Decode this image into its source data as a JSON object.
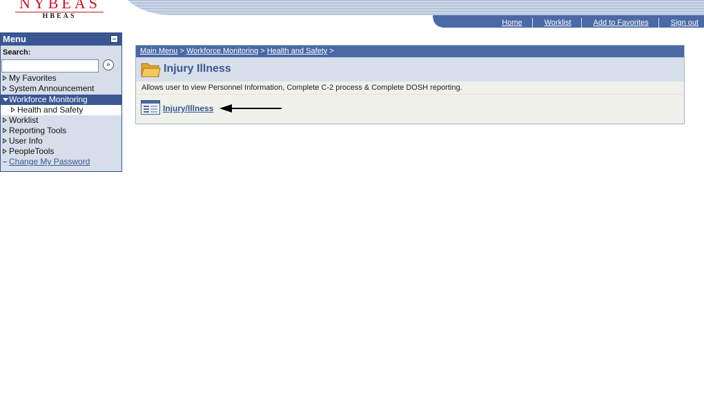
{
  "logo": {
    "title": "NYBEAS",
    "subtitle": "HBEAS"
  },
  "topnav": [
    "Home",
    "Worklist",
    "Add to Favorites",
    "Sign out"
  ],
  "menu": {
    "title": "Menu",
    "search_label": "Search:",
    "search_value": "",
    "search_button_glyph": "»",
    "items": [
      {
        "label": "My Favorites"
      },
      {
        "label": "System Announcement"
      },
      {
        "label": "Workforce Monitoring"
      },
      {
        "label": "Health and Safety"
      },
      {
        "label": "Worklist"
      },
      {
        "label": "Reporting Tools"
      },
      {
        "label": "User Info"
      },
      {
        "label": "PeopleTools"
      },
      {
        "label": "Change My Password"
      }
    ]
  },
  "breadcrumb": {
    "items": [
      "Main Menu",
      "Workforce Monitoring",
      "Health and Safety"
    ],
    "separator": " > "
  },
  "page": {
    "title": "Injury Illness",
    "description": "Allows user to view Personnel Information, Complete C-2 process & Complete DOSH reporting.",
    "link_label": "Injury/Illness"
  },
  "colors": {
    "header_blue": "#3a5793",
    "breadcrumb_blue": "#4a69a5",
    "logo_red": "#cc1122"
  }
}
